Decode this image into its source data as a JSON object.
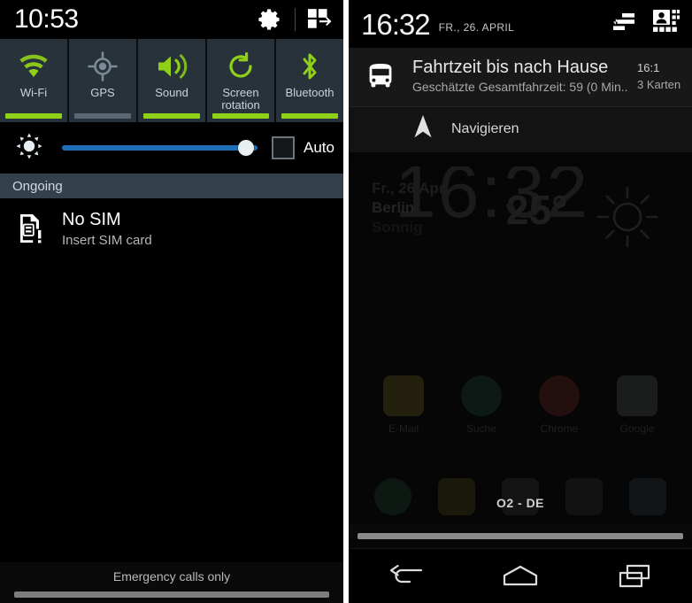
{
  "left_panel": {
    "status_bar": {
      "clock": "10:53",
      "settings_icon": "gear-icon",
      "arrange_icon": "grid-toggle-icon"
    },
    "quick_toggles": [
      {
        "label": "Wi-Fi",
        "icon": "wifi-icon",
        "state": "on",
        "color": "#8fd118"
      },
      {
        "label": "GPS",
        "icon": "gps-icon",
        "state": "off",
        "color": "#5a6872"
      },
      {
        "label": "Sound",
        "icon": "sound-icon",
        "state": "on",
        "color": "#8fd118"
      },
      {
        "label": "Screen rotation",
        "icon": "screen-rotation-icon",
        "state": "on",
        "color": "#8fd118"
      },
      {
        "label": "Bluetooth",
        "icon": "bluetooth-icon",
        "state": "on",
        "color": "#8fd118"
      }
    ],
    "brightness": {
      "icon": "brightness-sun-icon",
      "value_percent": 94,
      "track_color": "#1f6fb8",
      "auto_label": "Auto",
      "auto_checked": false
    },
    "section_header": "Ongoing",
    "notification": {
      "icon": "sim-card-alert-icon",
      "title": "No SIM",
      "subtitle": "Insert SIM card"
    },
    "footer": {
      "status_text": "Emergency calls only"
    }
  },
  "right_panel": {
    "status_bar": {
      "clock": "16:32",
      "date": "FR., 26. APRIL",
      "sort_icon": "sort-lines-icon",
      "contacts_icon": "contacts-grid-icon"
    },
    "notification": {
      "icon": "bus-icon",
      "title": "Fahrtzeit bis nach Hause",
      "subtitle": "Geschätzte Gesamtfahrzeit: 59 (0 Min..",
      "time": "16:1",
      "meta": "3 Karten"
    },
    "action": {
      "icon": "navigation-arrow-icon",
      "label": "Navigieren"
    },
    "background_home": {
      "clock": "16:32",
      "date": "Fr., 26 Apr",
      "city": "Berlin",
      "condition": "Sonnig",
      "temperature": "25°",
      "weather_icon": "sun-icon",
      "apps": [
        {
          "name": "E-Mail",
          "color": "#d6c23a"
        },
        {
          "name": "Suche",
          "color": "#2f8f6e"
        },
        {
          "name": "Chrome",
          "color": "#d24a36"
        },
        {
          "name": "Google",
          "color": "#9aa0a6"
        }
      ],
      "dock": [
        {
          "name": "phone-icon",
          "color": "#3fae6e"
        },
        {
          "name": "messaging-icon",
          "color": "#c9b83a"
        },
        {
          "name": "apps-icon",
          "color": "#8a8a8a"
        },
        {
          "name": "camera-icon",
          "color": "#777777"
        },
        {
          "name": "browser-icon",
          "color": "#6b8fb0"
        }
      ],
      "carrier": "O2 - DE"
    },
    "navbar": [
      {
        "name": "back-button",
        "icon": "back-arrow-icon"
      },
      {
        "name": "home-button",
        "icon": "home-icon"
      },
      {
        "name": "recents-button",
        "icon": "recents-icon"
      }
    ]
  }
}
